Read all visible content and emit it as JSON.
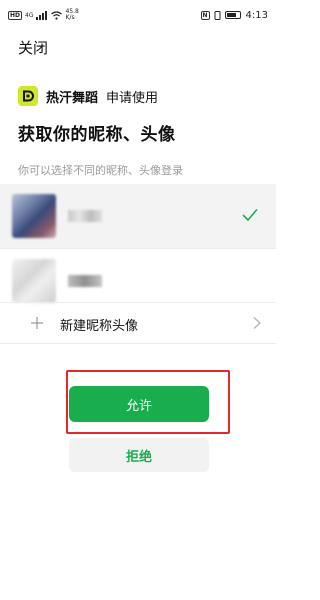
{
  "status_bar": {
    "left_chip": "HD",
    "network": "4G",
    "speed_value": "45.8",
    "speed_unit": "K/s",
    "nfc_chip": "N",
    "time": "4:13"
  },
  "header": {
    "close_label": "关闭"
  },
  "app": {
    "name": "热汗舞蹈",
    "action": "申请使用",
    "logo_color": "#cfe82a"
  },
  "heading": "获取你的昵称、头像",
  "subtitle": "你可以选择不同的昵称、头像登录",
  "accounts": [
    {
      "selected": true
    },
    {
      "selected": false
    }
  ],
  "new_nickname": {
    "label": "新建昵称头像"
  },
  "buttons": {
    "allow": "允许",
    "reject": "拒绝"
  },
  "colors": {
    "accent": "#1aad4d",
    "highlight": "#e02a2a"
  }
}
